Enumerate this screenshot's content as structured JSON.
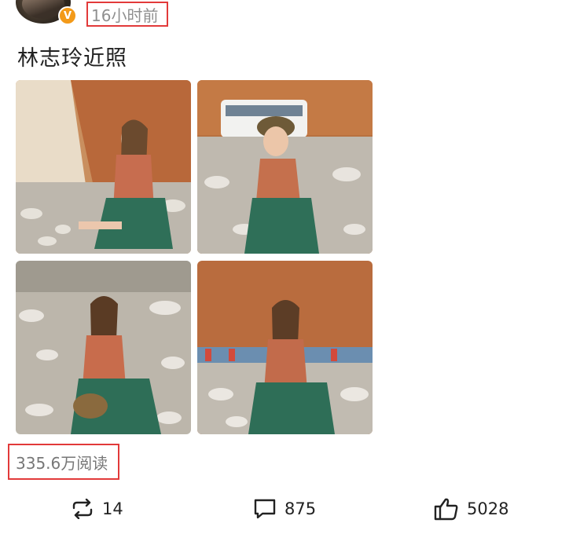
{
  "post": {
    "time": "16小时前",
    "title": "林志玲近照",
    "reads": "335.6万阅读",
    "verified_badge": "V"
  },
  "actions": {
    "repost_count": "14",
    "comment_count": "875",
    "like_count": "5028"
  },
  "icons": {
    "avatar": "avatar",
    "verified": "verified-badge-icon",
    "repost": "repost-icon",
    "comment": "comment-icon",
    "like": "thumbs-up-icon"
  },
  "colors": {
    "highlight_box": "#e23a3a",
    "badge": "#f39a19"
  }
}
